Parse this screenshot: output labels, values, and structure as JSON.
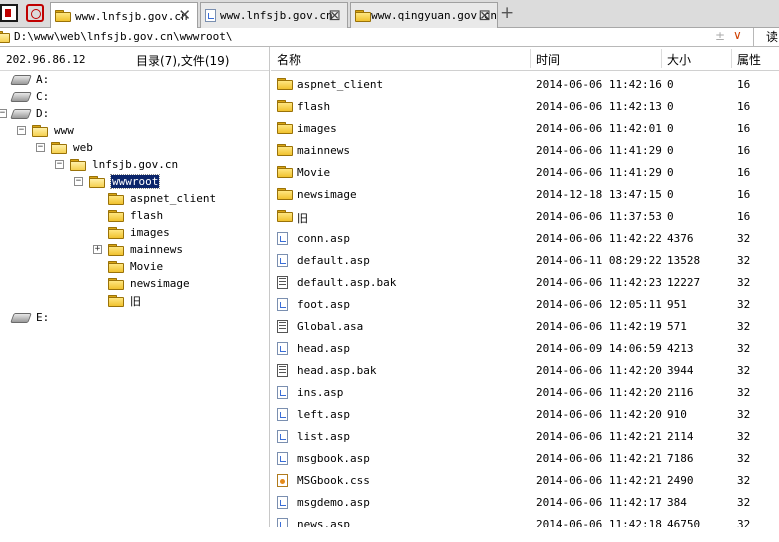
{
  "tabs": [
    {
      "label": "www.lnfsjb.gov.cn",
      "close": "✕",
      "icon": "folder-icon",
      "active": true
    },
    {
      "label": "www.lnfsjb.gov.cn",
      "close": "⊠",
      "icon": "file-icon",
      "active": false
    },
    {
      "label": "www.qingyuan.gov.cn",
      "close": "⊠",
      "icon": "folder-icon",
      "active": false
    }
  ],
  "tab_add": "+",
  "address": {
    "path": "D:\\www\\web\\lnfsjb.gov.cn\\wwwroot\\",
    "plusminus": "±",
    "dropdown": "∨",
    "read_button": "读"
  },
  "left": {
    "ip": "202.96.86.12",
    "count": "目录(7),文件(19)",
    "tree": [
      {
        "label": "A:",
        "type": "drive"
      },
      {
        "label": "C:",
        "type": "drive"
      },
      {
        "label": "D:",
        "type": "drive",
        "expander": "−"
      },
      {
        "label": "www",
        "type": "folder",
        "expander": "−"
      },
      {
        "label": "web",
        "type": "folder",
        "expander": "−"
      },
      {
        "label": "lnfsjb.gov.cn",
        "type": "folder",
        "expander": "−"
      },
      {
        "label": "wwwroot",
        "type": "folder",
        "expander": "−",
        "selected": true
      },
      {
        "label": "aspnet_client",
        "type": "folder"
      },
      {
        "label": "flash",
        "type": "folder"
      },
      {
        "label": "images",
        "type": "folder"
      },
      {
        "label": "mainnews",
        "type": "folder",
        "expander": "+"
      },
      {
        "label": "Movie",
        "type": "folder"
      },
      {
        "label": "newsimage",
        "type": "folder"
      },
      {
        "label": "旧",
        "type": "folder"
      },
      {
        "label": "E:",
        "type": "drive"
      }
    ]
  },
  "columns": {
    "name": "名称",
    "time": "时间",
    "size": "大小",
    "attr": "属性"
  },
  "files": [
    {
      "name": "aspnet_client",
      "time": "2014-06-06 11:42:16",
      "size": "0",
      "attr": "16",
      "type": "folder"
    },
    {
      "name": "flash",
      "time": "2014-06-06 11:42:13",
      "size": "0",
      "attr": "16",
      "type": "folder"
    },
    {
      "name": "images",
      "time": "2014-06-06 11:42:01",
      "size": "0",
      "attr": "16",
      "type": "folder"
    },
    {
      "name": "mainnews",
      "time": "2014-06-06 11:41:29",
      "size": "0",
      "attr": "16",
      "type": "folder"
    },
    {
      "name": "Movie",
      "time": "2014-06-06 11:41:29",
      "size": "0",
      "attr": "16",
      "type": "folder"
    },
    {
      "name": "newsimage",
      "time": "2014-12-18 13:47:15",
      "size": "0",
      "attr": "16",
      "type": "folder"
    },
    {
      "name": "旧",
      "time": "2014-06-06 11:37:53",
      "size": "0",
      "attr": "16",
      "type": "folder"
    },
    {
      "name": "conn.asp",
      "time": "2014-06-06 11:42:22",
      "size": "4376",
      "attr": "32",
      "type": "file"
    },
    {
      "name": "default.asp",
      "time": "2014-06-11 08:29:22",
      "size": "13528",
      "attr": "32",
      "type": "file"
    },
    {
      "name": "default.asp.bak",
      "time": "2014-06-06 11:42:23",
      "size": "12227",
      "attr": "32",
      "type": "bak"
    },
    {
      "name": "foot.asp",
      "time": "2014-06-06 12:05:11",
      "size": "951",
      "attr": "32",
      "type": "file"
    },
    {
      "name": "Global.asa",
      "time": "2014-06-06 11:42:19",
      "size": "571",
      "attr": "32",
      "type": "bak"
    },
    {
      "name": "head.asp",
      "time": "2014-06-09 14:06:59",
      "size": "4213",
      "attr": "32",
      "type": "file"
    },
    {
      "name": "head.asp.bak",
      "time": "2014-06-06 11:42:20",
      "size": "3944",
      "attr": "32",
      "type": "bak"
    },
    {
      "name": "ins.asp",
      "time": "2014-06-06 11:42:20",
      "size": "2116",
      "attr": "32",
      "type": "file"
    },
    {
      "name": "left.asp",
      "time": "2014-06-06 11:42:20",
      "size": "910",
      "attr": "32",
      "type": "file"
    },
    {
      "name": "list.asp",
      "time": "2014-06-06 11:42:21",
      "size": "2114",
      "attr": "32",
      "type": "file"
    },
    {
      "name": "msgbook.asp",
      "time": "2014-06-06 11:42:21",
      "size": "7186",
      "attr": "32",
      "type": "file"
    },
    {
      "name": "MSGbook.css",
      "time": "2014-06-06 11:42:21",
      "size": "2490",
      "attr": "32",
      "type": "css"
    },
    {
      "name": "msgdemo.asp",
      "time": "2014-06-06 11:42:17",
      "size": "384",
      "attr": "32",
      "type": "file"
    },
    {
      "name": "news.asp",
      "time": "2014-06-06 11:42:18",
      "size": "46750",
      "attr": "32",
      "type": "file"
    }
  ],
  "colors": {
    "selection": "#0a246a",
    "folder": "#f0c22e",
    "tabbar": "#dcdcdc"
  }
}
